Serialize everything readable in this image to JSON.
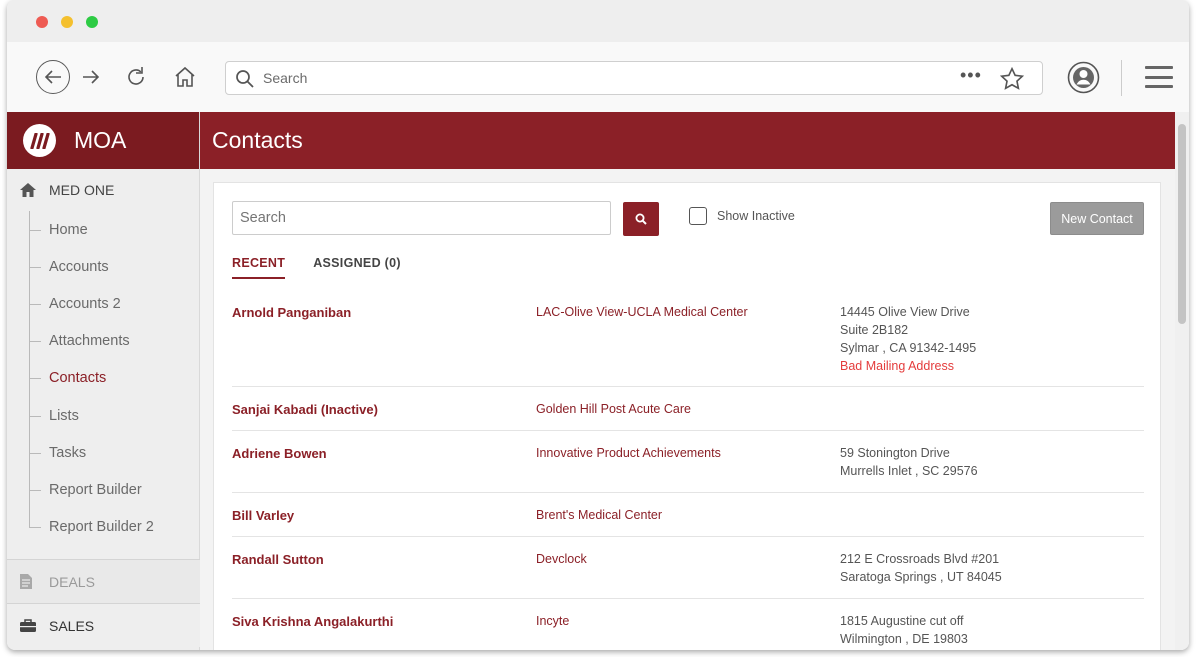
{
  "browser": {
    "url_placeholder": "Search",
    "more_label": "•••"
  },
  "sidebar": {
    "brand_name": "MOA",
    "section_label": "MED ONE",
    "items": [
      {
        "label": "Home"
      },
      {
        "label": "Accounts"
      },
      {
        "label": "Accounts 2"
      },
      {
        "label": "Attachments"
      },
      {
        "label": "Contacts"
      },
      {
        "label": "Lists"
      },
      {
        "label": "Tasks"
      },
      {
        "label": "Report Builder"
      },
      {
        "label": "Report Builder 2"
      }
    ],
    "active_item": "Contacts",
    "deals_label": "DEALS",
    "sales_label": "SALES"
  },
  "main": {
    "title": "Contacts",
    "search_placeholder": "Search",
    "show_inactive_label": "Show Inactive",
    "show_inactive_checked": false,
    "new_contact_label": "New Contact",
    "tabs": [
      {
        "label": "RECENT",
        "active": true
      },
      {
        "label": "ASSIGNED (0)",
        "active": false
      }
    ],
    "contacts": [
      {
        "name": "Arnold Panganiban",
        "org": "LAC-Olive View-UCLA Medical Center",
        "address": [
          "14445 Olive View Drive",
          "Suite 2B182",
          "Sylmar , CA 91342-1495"
        ],
        "warning": "Bad Mailing Address"
      },
      {
        "name": "Sanjai Kabadi (Inactive)",
        "org": "Golden Hill Post Acute Care",
        "address": [],
        "warning": ""
      },
      {
        "name": "Adriene Bowen",
        "org": "Innovative Product Achievements",
        "address": [
          "59 Stonington Drive",
          "Murrells Inlet , SC 29576"
        ],
        "warning": ""
      },
      {
        "name": "Bill Varley",
        "org": "Brent's Medical Center",
        "address": [],
        "warning": ""
      },
      {
        "name": "Randall Sutton",
        "org": "Devclock",
        "address": [
          "212 E Crossroads Blvd #201",
          "Saratoga Springs , UT 84045"
        ],
        "warning": ""
      },
      {
        "name": "Siva Krishna Angalakurthi",
        "org": "Incyte",
        "address": [
          "1815 Augustine cut off",
          "Wilmington , DE 19803"
        ],
        "warning": ""
      }
    ]
  },
  "colors": {
    "brand_dark": "#7b1b20",
    "brand": "#8b2027",
    "warning": "#e43c3c",
    "new_contact_bg": "#9b9b9b"
  }
}
